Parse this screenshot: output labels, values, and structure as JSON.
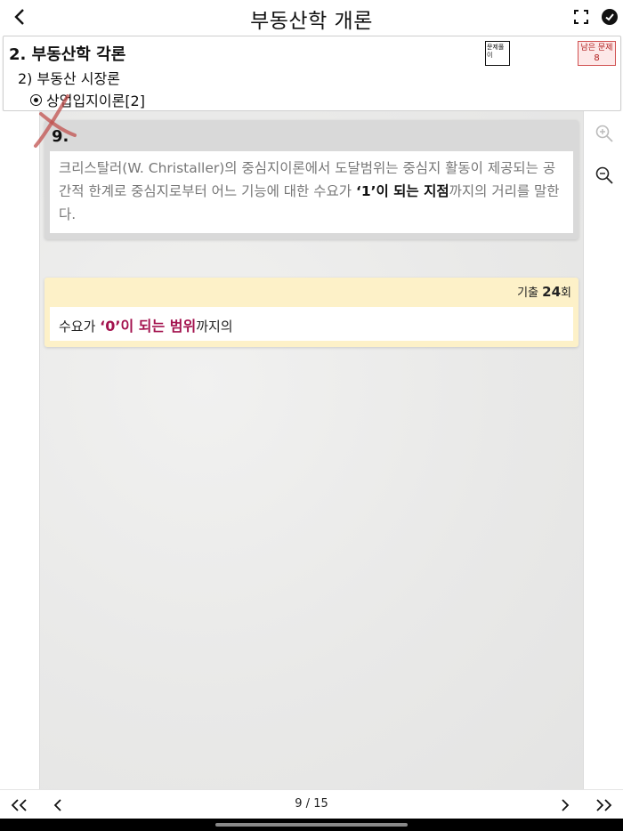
{
  "app": {
    "title": "부동산학 개론"
  },
  "breadcrumb": {
    "level1": "2. 부동산학 각론",
    "level2": "2) 부동산 시장론",
    "level3": "상업입지이론[2]"
  },
  "header_buttons": {
    "solve_label": "문제풀이",
    "remaining_label": "남은 문제",
    "remaining_count": "8"
  },
  "question": {
    "number": "9.",
    "text_before": "크리스탈러(W. Christaller)의 중심지이론에서 도달범위는 중심지 활동이 제공되는 공간적 한계로 중심지로부터 어느 기능에 대한 수요가 ",
    "text_bold": "‘1’이 되는 지점",
    "text_after": "까지의 거리를 말한다.",
    "result_mark": "wrong"
  },
  "answer": {
    "exam_prefix": "기출 ",
    "exam_number": "24",
    "exam_suffix": "회",
    "text_before": "수요가 ",
    "text_bold": "‘0’이 되는 범위",
    "text_after": "까지의"
  },
  "pagination": {
    "current": "9",
    "separator": " / ",
    "total": "15"
  },
  "colors": {
    "answer_highlight": "#a3124e",
    "answer_card_bg": "#fdf1c8",
    "wrong_mark": "#c0504d",
    "remaining_border": "#d05050"
  }
}
